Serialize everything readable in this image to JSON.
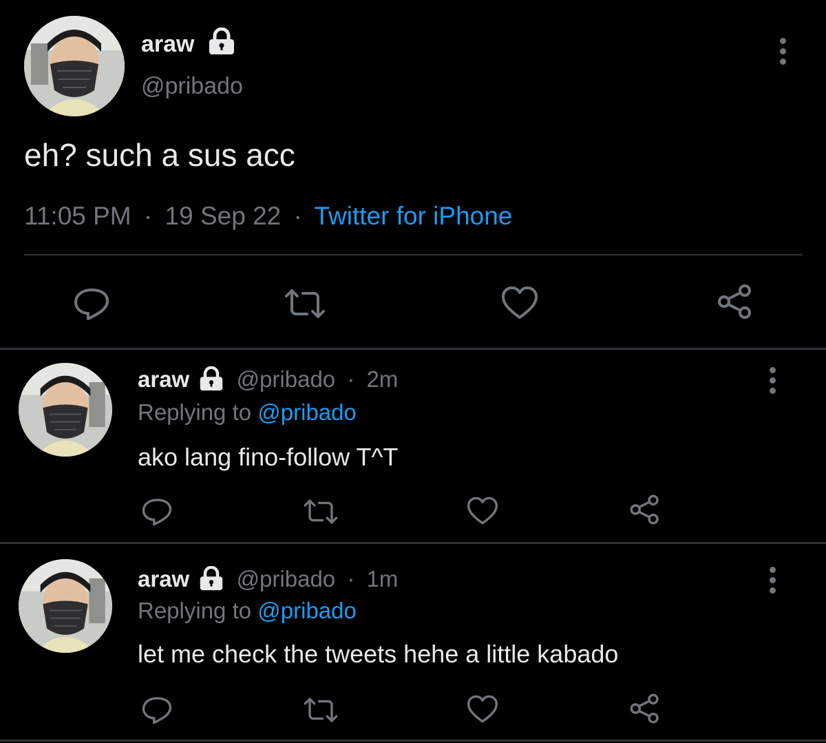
{
  "main_tweet": {
    "display_name": "araw",
    "handle": "@pribado",
    "text": "eh? such a sus acc",
    "time": "11:05 PM",
    "date": "19 Sep 22",
    "source": "Twitter for iPhone",
    "sep": "·"
  },
  "replies": [
    {
      "display_name": "araw",
      "handle": "@pribado",
      "age": "2m",
      "replying_prefix": "Replying to",
      "replying_to": "@pribado",
      "text": "ako lang fino-follow T^T",
      "sep": "·"
    },
    {
      "display_name": "araw",
      "handle": "@pribado",
      "age": "1m",
      "replying_prefix": "Replying to",
      "replying_to": "@pribado",
      "text": "let me check the tweets hehe a little kabado",
      "sep": "·"
    }
  ],
  "colors": {
    "background": "#000000",
    "text": "#e7e9ea",
    "muted": "#71767b",
    "accent": "#1d9bf0",
    "divider": "#2f3336"
  },
  "icons": [
    "lock-icon",
    "more-icon",
    "reply-icon",
    "retweet-icon",
    "like-icon",
    "share-icon"
  ]
}
